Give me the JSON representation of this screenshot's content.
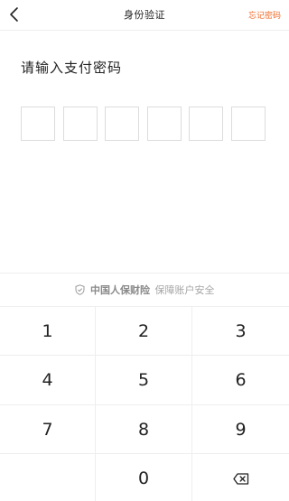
{
  "header": {
    "title": "身份验证",
    "forgot_label": "忘记密码"
  },
  "prompt": "请输入支付密码",
  "pin_length": 6,
  "insurance": {
    "brand": "中国人保财险",
    "slogan": "保障账户安全"
  },
  "keypad": {
    "keys": [
      "1",
      "2",
      "3",
      "4",
      "5",
      "6",
      "7",
      "8",
      "9",
      "",
      "0",
      "delete-icon"
    ]
  },
  "colors": {
    "accent": "#f06a2a",
    "border": "#dcdcdc",
    "divider": "#eeeeee"
  }
}
